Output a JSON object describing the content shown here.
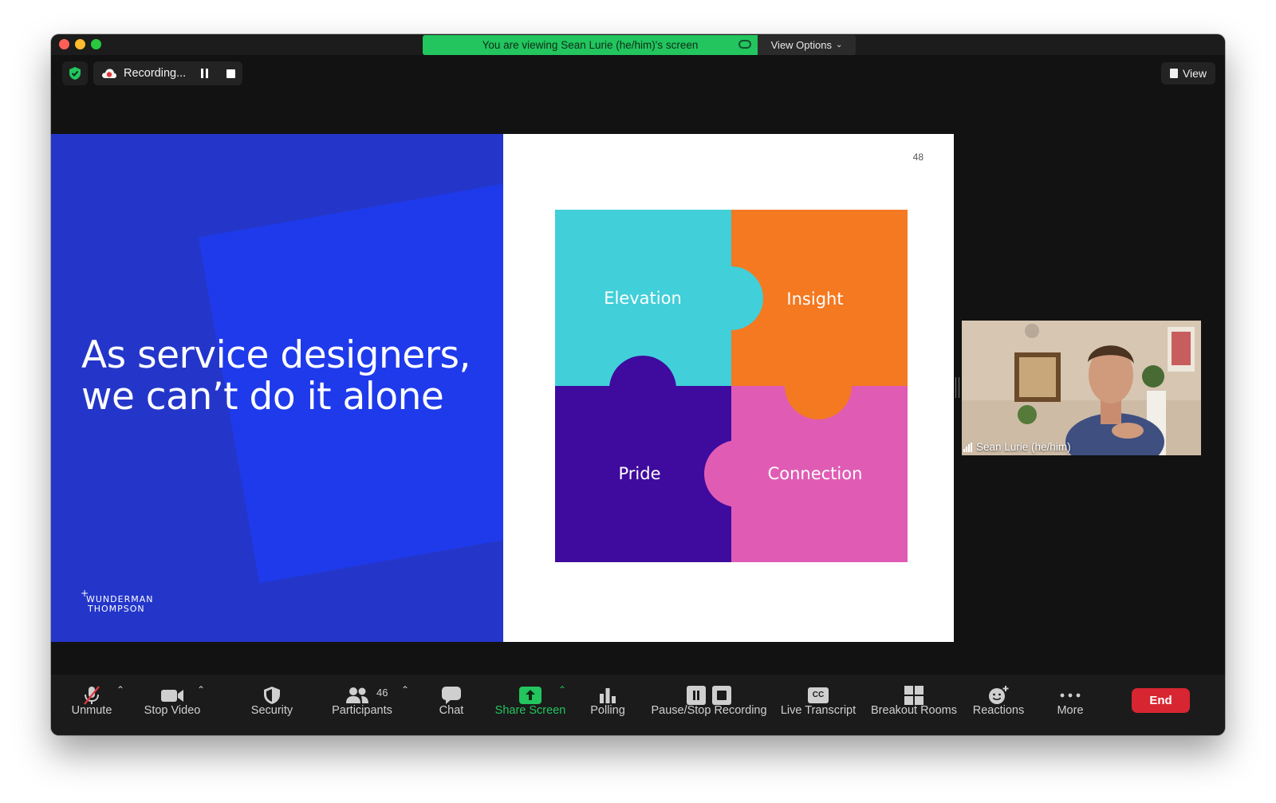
{
  "top": {
    "share_banner": "You are viewing Sean Lurie (he/him)'s screen",
    "view_options": "View Options",
    "recording_label": "Recording...",
    "view_button": "View"
  },
  "slide": {
    "headline_line1": "As service designers,",
    "headline_line2": "we can’t do it alone",
    "logo_line1": "WUNDERMAN",
    "logo_line2": "THOMPSON",
    "page_number": "48",
    "pieces": [
      "Elevation",
      "Insight",
      "Pride",
      "Connection"
    ],
    "colors": {
      "left_panel": "#2436c9",
      "elevation": "#41cfd9",
      "insight": "#f47921",
      "pride": "#3f0a9e",
      "connection": "#e05cb4"
    }
  },
  "participant": {
    "name": "Sean Lurie (he/him)"
  },
  "toolbar": {
    "unmute": "Unmute",
    "stop_video": "Stop Video",
    "security": "Security",
    "participants": "Participants",
    "participant_count": "46",
    "chat": "Chat",
    "share_screen": "Share Screen",
    "polling": "Polling",
    "pause_stop_recording": "Pause/Stop Recording",
    "live_transcript": "Live Transcript",
    "live_transcript_badge": "CC",
    "breakout_rooms": "Breakout Rooms",
    "reactions": "Reactions",
    "more": "More",
    "end": "End"
  }
}
